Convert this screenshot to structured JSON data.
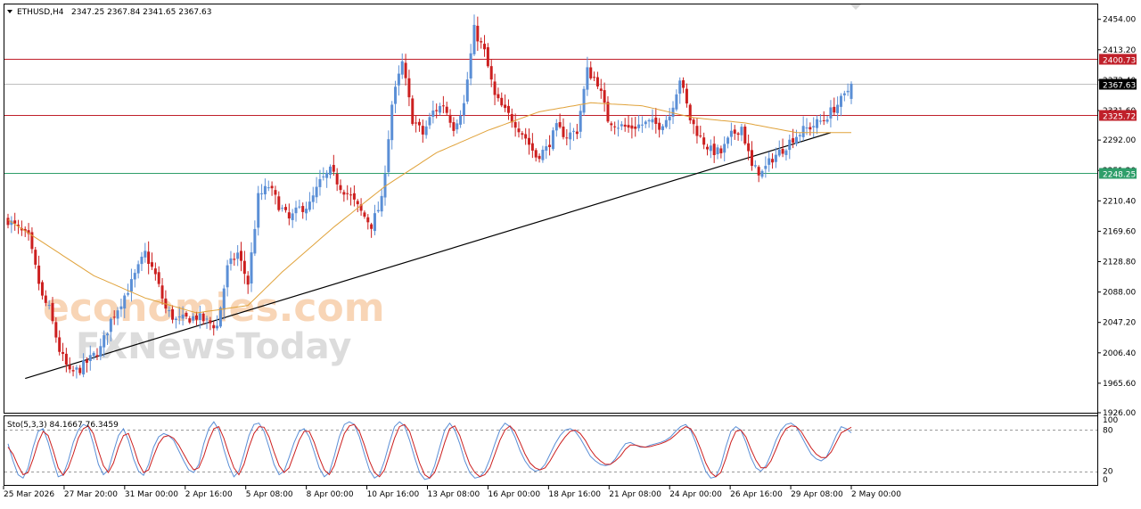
{
  "header": {
    "symbol": "ETHUSD,H4",
    "ohlc": "2347.25 2367.84 2341.65 2367.63"
  },
  "watermark": {
    "line1": "economies.com",
    "line2": "FXNewsToday"
  },
  "colors": {
    "bull": "#5b8fd6",
    "bear": "#cc1f1f",
    "ma": "#e0a23a",
    "resistance": "#c0202a",
    "support": "#2e9e6a",
    "current": "#bfbfbf",
    "trendline": "#000000",
    "stoch_k": "#5b8fd6",
    "stoch_d": "#cc1f1f"
  },
  "chart_data": [
    {
      "type": "candlestick",
      "y_ticks": [
        "2454.00",
        "2413.20",
        "2372.40",
        "2331.60",
        "2292.00",
        "2251.20",
        "2210.40",
        "2169.60",
        "2128.80",
        "2088.00",
        "2047.20",
        "2006.40",
        "1965.60",
        "1926.00"
      ],
      "ylim": [
        1926,
        2474
      ],
      "x_ticks": [
        "25 Mar 2026",
        "27 Mar 20:00",
        "31 Mar 00:00",
        "2 Apr 16:00",
        "5 Apr 08:00",
        "8 Apr 00:00",
        "10 Apr 16:00",
        "13 Apr 08:00",
        "16 Apr 00:00",
        "18 Apr 16:00",
        "21 Apr 08:00",
        "24 Apr 00:00",
        "26 Apr 16:00",
        "29 Apr 08:00",
        "2 May 00:00"
      ],
      "levels": [
        {
          "value": 2400.73,
          "label": "2400.73",
          "kind": "resistance"
        },
        {
          "value": 2367.63,
          "label": "2367.63",
          "kind": "current"
        },
        {
          "value": 2325.72,
          "label": "2325.72",
          "kind": "resistance"
        },
        {
          "value": 2248.25,
          "label": "2248.25",
          "kind": "support"
        }
      ],
      "trendline": {
        "from": [
          5,
          1972
        ],
        "to": [
          240,
          2302
        ]
      },
      "close_anchors": [
        [
          0,
          2185
        ],
        [
          3,
          2172
        ],
        [
          6,
          2160
        ],
        [
          10,
          2080
        ],
        [
          12,
          2065
        ],
        [
          15,
          2010
        ],
        [
          18,
          1978
        ],
        [
          21,
          1985
        ],
        [
          24,
          1998
        ],
        [
          27,
          2012
        ],
        [
          30,
          2050
        ],
        [
          33,
          2075
        ],
        [
          36,
          2100
        ],
        [
          40,
          2140
        ],
        [
          43,
          2110
        ],
        [
          46,
          2065
        ],
        [
          49,
          2050
        ],
        [
          52,
          2052
        ],
        [
          55,
          2055
        ],
        [
          58,
          2048
        ],
        [
          61,
          2042
        ],
        [
          64,
          2120
        ],
        [
          67,
          2140
        ],
        [
          70,
          2100
        ],
        [
          73,
          2215
        ],
        [
          76,
          2230
        ],
        [
          79,
          2205
        ],
        [
          82,
          2185
        ],
        [
          85,
          2200
        ],
        [
          88,
          2205
        ],
        [
          91,
          2235
        ],
        [
          94,
          2250
        ],
        [
          97,
          2230
        ],
        [
          100,
          2215
        ],
        [
          103,
          2195
        ],
        [
          106,
          2178
        ],
        [
          109,
          2210
        ],
        [
          112,
          2340
        ],
        [
          115,
          2395
        ],
        [
          118,
          2320
        ],
        [
          121,
          2300
        ],
        [
          124,
          2330
        ],
        [
          127,
          2340
        ],
        [
          130,
          2310
        ],
        [
          133,
          2340
        ],
        [
          136,
          2440
        ],
        [
          139,
          2410
        ],
        [
          142,
          2350
        ],
        [
          145,
          2330
        ],
        [
          148,
          2315
        ],
        [
          151,
          2295
        ],
        [
          154,
          2270
        ],
        [
          157,
          2280
        ],
        [
          160,
          2308
        ],
        [
          163,
          2298
        ],
        [
          166,
          2305
        ],
        [
          169,
          2385
        ],
        [
          172,
          2370
        ],
        [
          175,
          2320
        ],
        [
          178,
          2312
        ],
        [
          181,
          2308
        ],
        [
          184,
          2312
        ],
        [
          187,
          2315
        ],
        [
          190,
          2312
        ],
        [
          193,
          2325
        ],
        [
          196,
          2375
        ],
        [
          199,
          2320
        ],
        [
          202,
          2295
        ],
        [
          205,
          2278
        ],
        [
          208,
          2275
        ],
        [
          211,
          2298
        ],
        [
          214,
          2310
        ],
        [
          217,
          2255
        ],
        [
          220,
          2248
        ],
        [
          223,
          2268
        ],
        [
          226,
          2280
        ],
        [
          229,
          2295
        ],
        [
          232,
          2305
        ],
        [
          235,
          2312
        ],
        [
          238,
          2320
        ],
        [
          241,
          2335
        ],
        [
          244,
          2350
        ],
        [
          246,
          2367.63
        ]
      ],
      "ma_anchors": [
        [
          0,
          2185
        ],
        [
          10,
          2155
        ],
        [
          25,
          2110
        ],
        [
          40,
          2080
        ],
        [
          55,
          2060
        ],
        [
          70,
          2070
        ],
        [
          80,
          2115
        ],
        [
          95,
          2175
        ],
        [
          110,
          2230
        ],
        [
          125,
          2275
        ],
        [
          140,
          2305
        ],
        [
          155,
          2330
        ],
        [
          170,
          2342
        ],
        [
          185,
          2338
        ],
        [
          200,
          2322
        ],
        [
          215,
          2315
        ],
        [
          230,
          2302
        ],
        [
          246,
          2302
        ]
      ]
    },
    {
      "type": "line",
      "title": "Sto(5,3,3) 84.1667 76.3459",
      "y_ticks": [
        "100",
        "80",
        "20",
        "0"
      ],
      "ylim": [
        0,
        100
      ],
      "levels": [
        80,
        20
      ],
      "series": [
        {
          "values": [
            60,
            35,
            15,
            10,
            25,
            55,
            78,
            82,
            62,
            35,
            12,
            15,
            35,
            62,
            80,
            88,
            85,
            60,
            30,
            15,
            22,
            48,
            72,
            82,
            65,
            38,
            20,
            14,
            30,
            55,
            70,
            75,
            72,
            65,
            50,
            35,
            22,
            18,
            30,
            60,
            82,
            92,
            80,
            52,
            28,
            12,
            20,
            45,
            72,
            88,
            90,
            78,
            55,
            30,
            15,
            20,
            40,
            62,
            78,
            82,
            70,
            48,
            25,
            12,
            18,
            42,
            70,
            88,
            92,
            88,
            70,
            45,
            22,
            10,
            15,
            35,
            62,
            85,
            92,
            86,
            65,
            40,
            18,
            8,
            10,
            28,
            55,
            80,
            90,
            80,
            60,
            35,
            18,
            10,
            12,
            20,
            38,
            60,
            80,
            90,
            85,
            70,
            50,
            35,
            25,
            20,
            22,
            30,
            45,
            60,
            72,
            80,
            82,
            78,
            68,
            55,
            42,
            35,
            30,
            28,
            30,
            38,
            50,
            60,
            62,
            58,
            55,
            55,
            58,
            60,
            62,
            65,
            70,
            78,
            85,
            88,
            80,
            62,
            40,
            20,
            10,
            12,
            28,
            55,
            78,
            85,
            80,
            62,
            40,
            25,
            20,
            28,
            45,
            65,
            80,
            88,
            90,
            85,
            72,
            58,
            45,
            38,
            35,
            40,
            55,
            72,
            85,
            82,
            76
          ]
        },
        {
          "values": [
            55,
            45,
            28,
            15,
            18,
            38,
            62,
            78,
            72,
            50,
            25,
            14,
            25,
            45,
            68,
            82,
            86,
            75,
            50,
            28,
            18,
            32,
            55,
            72,
            75,
            55,
            32,
            18,
            22,
            42,
            60,
            70,
            72,
            68,
            58,
            45,
            32,
            22,
            25,
            42,
            65,
            82,
            85,
            68,
            45,
            25,
            15,
            30,
            55,
            75,
            85,
            84,
            70,
            48,
            28,
            18,
            25,
            45,
            65,
            78,
            78,
            62,
            40,
            22,
            15,
            28,
            52,
            75,
            86,
            88,
            78,
            58,
            35,
            18,
            12,
            22,
            45,
            68,
            85,
            88,
            78,
            55,
            32,
            15,
            10,
            18,
            38,
            62,
            82,
            86,
            72,
            50,
            30,
            18,
            12,
            15,
            25,
            45,
            65,
            80,
            86,
            78,
            62,
            45,
            32,
            25,
            22,
            25,
            35,
            48,
            60,
            70,
            78,
            80,
            75,
            65,
            52,
            42,
            35,
            30,
            30,
            35,
            42,
            52,
            58,
            58,
            56,
            55,
            56,
            58,
            60,
            63,
            67,
            73,
            80,
            85,
            82,
            70,
            52,
            32,
            18,
            12,
            18,
            38,
            62,
            78,
            80,
            70,
            52,
            36,
            25,
            25,
            35,
            52,
            70,
            82,
            86,
            85,
            78,
            66,
            54,
            45,
            40,
            40,
            48,
            62,
            76,
            80,
            84
          ]
        }
      ]
    }
  ]
}
